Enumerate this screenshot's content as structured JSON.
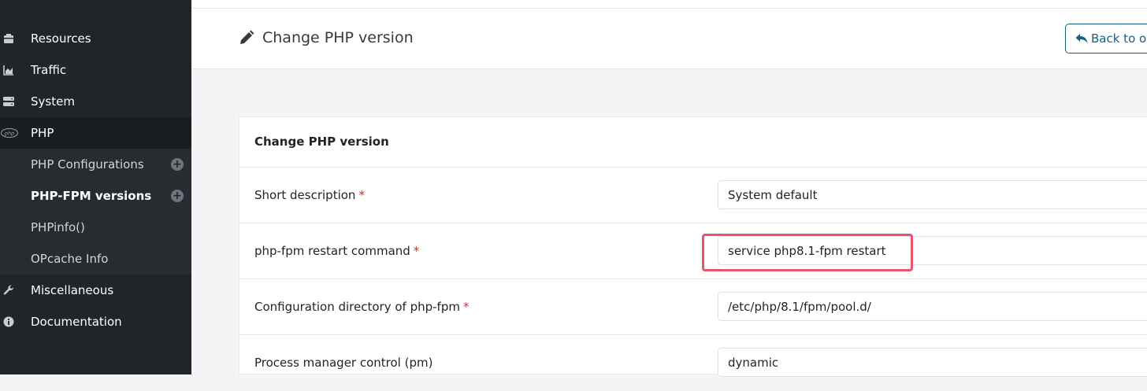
{
  "sidebar": {
    "items": [
      {
        "label": "Resources",
        "icon": "box-icon"
      },
      {
        "label": "Traffic",
        "icon": "chart-area-icon"
      },
      {
        "label": "System",
        "icon": "server-icon"
      },
      {
        "label": "PHP",
        "icon": "php-icon"
      },
      {
        "label": "Miscellaneous",
        "icon": "wrench-icon"
      },
      {
        "label": "Documentation",
        "icon": "info-circle-icon"
      }
    ],
    "php_sub": [
      {
        "label": "PHP Configurations"
      },
      {
        "label": "PHP-FPM versions"
      },
      {
        "label": "PHPinfo()"
      },
      {
        "label": "OPcache Info"
      }
    ]
  },
  "header": {
    "title": "Change PHP version",
    "back_label": "Back to ov"
  },
  "card": {
    "title": "Change PHP version",
    "rows": [
      {
        "label": "Short description",
        "required": "*",
        "value": "System default"
      },
      {
        "label": "php-fpm restart command",
        "required": "*",
        "value": "service php8.1-fpm restart"
      },
      {
        "label": "Configuration directory of php-fpm",
        "required": "*",
        "value": "/etc/php/8.1/fpm/pool.d/"
      },
      {
        "label": "Process manager control (pm)",
        "required": "",
        "value": "dynamic"
      }
    ]
  },
  "colors": {
    "sidebar_bg": "#212529",
    "accent": "#17607e",
    "highlight": "#e9546b",
    "required": "#c0392b"
  }
}
